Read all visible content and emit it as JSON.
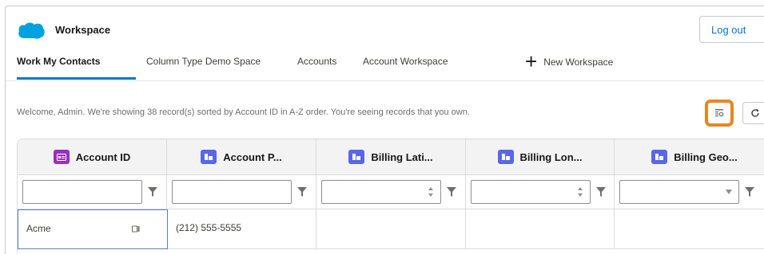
{
  "app": {
    "title": "Workspace",
    "logout_label": "Log out",
    "logo_icon": "cloud-icon",
    "brand_color": "#00a1e0"
  },
  "tabs": [
    {
      "label": "Work My Contacts",
      "active": true
    },
    {
      "label": "Column Type Demo Space",
      "active": false
    },
    {
      "label": "Accounts",
      "active": false
    },
    {
      "label": "Account Workspace",
      "active": false
    }
  ],
  "new_workspace_label": "New Workspace",
  "welcome_text": "Welcome, Admin. We're showing 38 record(s) sorted by Account ID in A-Z order. You're seeing records that you own.",
  "toolbar": {
    "columns_icon": "column-settings-icon",
    "refresh_icon": "refresh-icon",
    "highlight_color": "#e8861e"
  },
  "grid": {
    "columns": [
      {
        "label": "Account ID",
        "icon": "id-icon",
        "icon_color": "#9b2dbf",
        "filter": "text"
      },
      {
        "label": "Account P...",
        "icon": "field-icon",
        "icon_color": "#5867e8",
        "filter": "text"
      },
      {
        "label": "Billing Lati...",
        "icon": "field-icon",
        "icon_color": "#5867e8",
        "filter": "number"
      },
      {
        "label": "Billing Lon...",
        "icon": "field-icon",
        "icon_color": "#5867e8",
        "filter": "number"
      },
      {
        "label": "Billing Geo...",
        "icon": "field-icon",
        "icon_color": "#5867e8",
        "filter": "select"
      }
    ],
    "rows": [
      [
        "Acme",
        "(212) 555-5555",
        "",
        "",
        ""
      ]
    ]
  }
}
